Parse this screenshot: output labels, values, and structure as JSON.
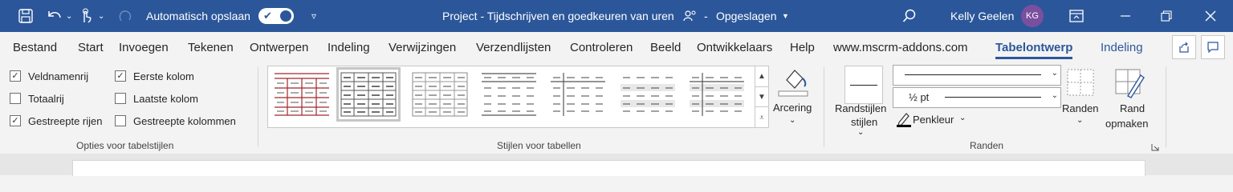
{
  "titlebar": {
    "autosave_label": "Automatisch opslaan",
    "autosave_state": "Aan",
    "document_title": "Project - Tijdschrijven en goedkeuren van uren",
    "save_state": "Opgeslagen",
    "user_name": "Kelly Geelen",
    "user_initials": "KG"
  },
  "tabs": [
    {
      "label": "Bestand"
    },
    {
      "label": "Start"
    },
    {
      "label": "Invoegen"
    },
    {
      "label": "Tekenen"
    },
    {
      "label": "Ontwerpen"
    },
    {
      "label": "Indeling"
    },
    {
      "label": "Verwijzingen"
    },
    {
      "label": "Verzendlijsten"
    },
    {
      "label": "Controleren"
    },
    {
      "label": "Beeld"
    },
    {
      "label": "Ontwikkelaars"
    },
    {
      "label": "Help"
    },
    {
      "label": "www.mscrm-addons.com"
    },
    {
      "label": "Tabelontwerp"
    },
    {
      "label": "Indeling"
    }
  ],
  "active_tab": "Tabelontwerp",
  "table_style_options": {
    "group_label": "Opties voor tabelstijlen",
    "items": [
      {
        "label": "Veldnamenrij",
        "checked": true
      },
      {
        "label": "Totaalrij",
        "checked": false
      },
      {
        "label": "Gestreepte rijen",
        "checked": true
      },
      {
        "label": "Eerste kolom",
        "checked": true
      },
      {
        "label": "Laatste kolom",
        "checked": false
      },
      {
        "label": "Gestreepte kolommen",
        "checked": false
      }
    ]
  },
  "table_styles": {
    "group_label": "Stijlen voor tabellen",
    "shading_label": "Arcering",
    "accent_color": "#a4262c"
  },
  "borders": {
    "group_label": "Randen",
    "border_styles_label_1": "Randstijlen",
    "line_weight": "½ pt",
    "pen_color_label": "Penkleur",
    "borders_label": "Randen",
    "border_painter_label_1": "Rand",
    "border_painter_label_2": "opmaken"
  },
  "colors": {
    "accent": "#2b579a"
  }
}
